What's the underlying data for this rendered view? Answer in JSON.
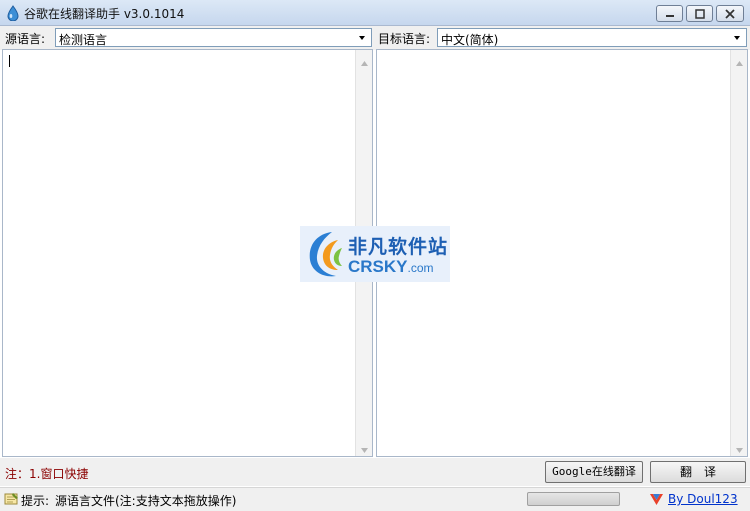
{
  "window": {
    "title": "谷歌在线翻译助手 v3.0.1014",
    "app_icon": "blue-droplet-icon",
    "controls": [
      "minimize-icon",
      "maximize-icon",
      "close-icon"
    ]
  },
  "languages": {
    "source_label": "源语言:",
    "source_value": "检测语言",
    "target_label": "目标语言:",
    "target_value": "中文(简体)"
  },
  "source_pane": {
    "text": ""
  },
  "target_pane": {
    "text": ""
  },
  "watermark": {
    "brand_cn": "非凡软件站",
    "brand_en": "CRSKY",
    "brand_domain": ".com"
  },
  "actions": {
    "note": "注：1.窗口快捷",
    "google_button": "Google在线翻译",
    "translate_button": "翻译"
  },
  "status": {
    "hint_icon": "notepad-icon",
    "hint_label": "提示:",
    "hint_text": "源语言文件(注:支持文本拖放操作)",
    "progress": 0,
    "author_icon": "heart-logo-icon",
    "author_link": "By Doul123"
  },
  "colors": {
    "note": "#8b0000",
    "link": "#0033cc",
    "logo": "#1d5fb3"
  }
}
